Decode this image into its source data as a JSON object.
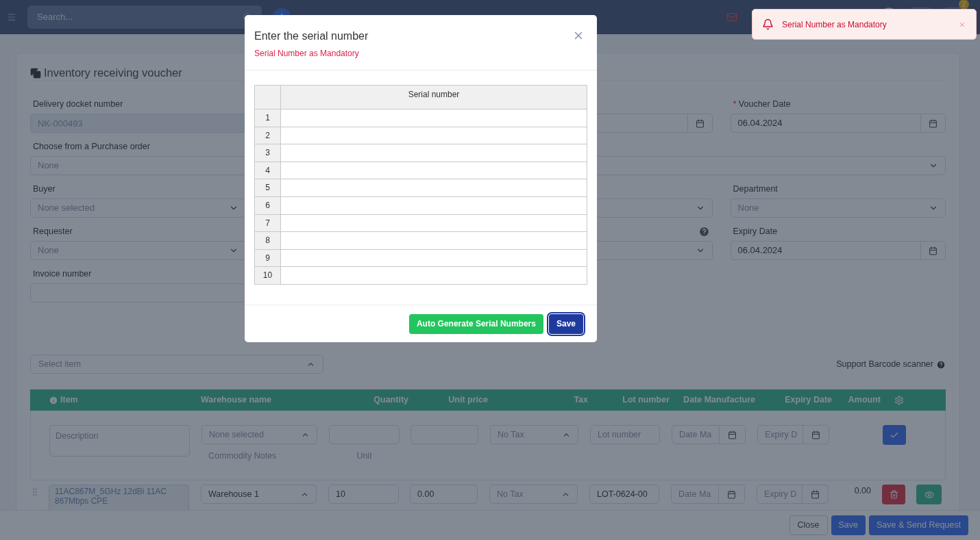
{
  "header": {
    "search": {
      "placeholder": "Search..."
    },
    "badge": "2"
  },
  "page": {
    "title": "Inventory receiving voucher",
    "form_rows": [
      [
        {
          "kind": "text",
          "label": "Delivery docket number",
          "value": "NK-000493",
          "disabled": true
        },
        {
          "kind": "covered"
        },
        {
          "kind": "date"
        },
        {
          "kind": "date",
          "label": "Voucher Date",
          "required_mark": "*",
          "value": "06.04.2024"
        }
      ],
      [
        {
          "kind": "select",
          "label": "Choose from a Purchase order",
          "placeholder": "None",
          "wide": true
        }
      ],
      [
        {
          "kind": "select",
          "label": "Buyer",
          "placeholder": "None selected"
        },
        {
          "kind": "covered"
        },
        {
          "kind": "select"
        },
        {
          "kind": "select",
          "label": "Department",
          "placeholder": "None"
        }
      ],
      [
        {
          "kind": "select",
          "label": "Requester",
          "placeholder": "None"
        },
        {
          "kind": "covered"
        },
        {
          "kind": "select",
          "help": true
        },
        {
          "kind": "date",
          "label": "Expiry Date",
          "value": "06.04.2024"
        }
      ],
      [
        {
          "kind": "text",
          "label": "Invoice number"
        },
        {
          "kind": "covered"
        },
        {
          "kind": "covered"
        },
        {
          "kind": "covered"
        }
      ]
    ],
    "item_picker": {
      "placeholder": "Select item"
    },
    "barcode_note": "Support Barcode scanner",
    "items_table": {
      "columns": [
        {
          "kind": "blank"
        },
        {
          "kind": "text",
          "label": "Item",
          "info": true
        },
        {
          "kind": "text",
          "label": "Warehouse name"
        },
        {
          "kind": "figure",
          "label": "Quantity"
        },
        {
          "kind": "figure",
          "label": "Unit price"
        },
        {
          "kind": "figure",
          "label": "Tax"
        },
        {
          "kind": "figure",
          "label": "Lot number"
        },
        {
          "kind": "figure",
          "label": "Date Manufacture"
        },
        {
          "kind": "figure",
          "label": "Expiry Date"
        },
        {
          "kind": "figure",
          "label": "Amount"
        },
        {
          "kind": "settings"
        },
        {
          "kind": "blank"
        }
      ],
      "entry_row": {
        "description": "Description",
        "warehouse": "None selected",
        "warehouse_note": "Commodity Notes",
        "unit_note": "Unit",
        "tax": "No Tax",
        "lot": "Lot number",
        "date": "Date Ma",
        "expiry": "Expiry D"
      },
      "rows": [
        {
          "description": "11AC867M_5GHz 12dBi 11AC 867Mbps CPE",
          "warehouse": "Warehouse 1",
          "quantity": "10",
          "unit_price": "0.00",
          "tax": "No Tax",
          "lot": "LOT-0624-00",
          "date_placeholder": "Date Ma",
          "expiry_placeholder": "Expiry D",
          "amount": "0.00"
        }
      ]
    },
    "footer_buttons": [
      {
        "label": "Close",
        "kind": "secondary"
      },
      {
        "label": "Save",
        "kind": "primary"
      },
      {
        "label": "Save & Send Request",
        "kind": "primary"
      }
    ]
  },
  "modal": {
    "title": "Enter the serial number",
    "subtitle": "Serial Number as Mandatory",
    "column": "Serial number",
    "rows": [
      "1",
      "2",
      "3",
      "4",
      "5",
      "6",
      "7",
      "8",
      "9",
      "10"
    ],
    "buttons": [
      {
        "label": "Auto Generate Serial Numbers",
        "kind": "success",
        "focused": false
      },
      {
        "label": "Save",
        "kind": "primary",
        "focused": true
      }
    ]
  },
  "toast": {
    "message": "Serial Number as Mandatory"
  }
}
